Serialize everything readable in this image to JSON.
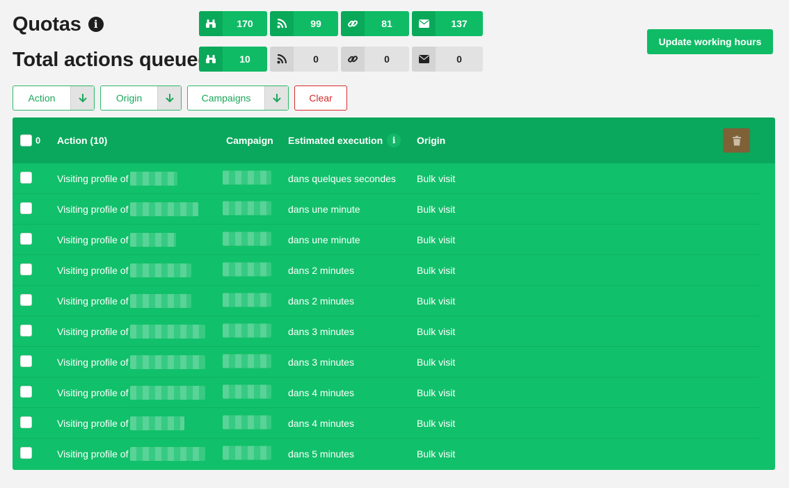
{
  "header": {
    "quotas_title": "Quotas",
    "total_title": "Total actions queued",
    "info_glyph": "i"
  },
  "quotas": [
    {
      "icon": "binoculars-icon",
      "value": "170"
    },
    {
      "icon": "rss-icon",
      "value": "99"
    },
    {
      "icon": "link-icon",
      "value": "81"
    },
    {
      "icon": "envelope-icon",
      "value": "137"
    }
  ],
  "queued": [
    {
      "icon": "binoculars-icon",
      "value": "10"
    },
    {
      "icon": "rss-icon",
      "value": "0"
    },
    {
      "icon": "link-icon",
      "value": "0"
    },
    {
      "icon": "envelope-icon",
      "value": "0"
    }
  ],
  "update_button": "Update working hours",
  "filters": {
    "action": "Action",
    "origin": "Origin",
    "campaigns": "Campaigns",
    "clear": "Clear"
  },
  "table": {
    "selected_count": "0",
    "headers": {
      "action": "Action (10)",
      "campaign": "Campaign",
      "estimated": "Estimated execution",
      "origin": "Origin"
    },
    "rows": [
      {
        "action": "Visiting profile of",
        "estimated": "dans quelques secondes",
        "origin": "Bulk visit"
      },
      {
        "action": "Visiting profile of",
        "estimated": "dans une minute",
        "origin": "Bulk visit"
      },
      {
        "action": "Visiting profile of",
        "estimated": "dans une minute",
        "origin": "Bulk visit"
      },
      {
        "action": "Visiting profile of",
        "estimated": "dans 2 minutes",
        "origin": "Bulk visit"
      },
      {
        "action": "Visiting profile of",
        "estimated": "dans 2 minutes",
        "origin": "Bulk visit"
      },
      {
        "action": "Visiting profile of",
        "estimated": "dans 3 minutes",
        "origin": "Bulk visit"
      },
      {
        "action": "Visiting profile of",
        "estimated": "dans 3 minutes",
        "origin": "Bulk visit"
      },
      {
        "action": "Visiting profile of",
        "estimated": "dans 4 minutes",
        "origin": "Bulk visit"
      },
      {
        "action": "Visiting profile of",
        "estimated": "dans 4 minutes",
        "origin": "Bulk visit"
      },
      {
        "action": "Visiting profile of",
        "estimated": "dans 5 minutes",
        "origin": "Bulk visit"
      }
    ]
  },
  "colors": {
    "accent": "#10bb66",
    "header": "#0aa85c",
    "danger": "#d32a2a",
    "trash": "#7f6138"
  }
}
